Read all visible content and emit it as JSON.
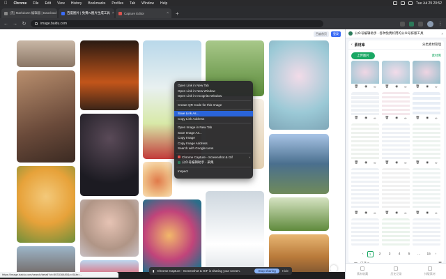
{
  "menubar": {
    "app": "Chrome",
    "menus": [
      "File",
      "Edit",
      "View",
      "History",
      "Bookmarks",
      "Profiles",
      "Tab",
      "Window",
      "Help"
    ],
    "clock": "Tue Jul 29 20:52"
  },
  "tabs": [
    {
      "label": "(无) Markdown 编辑器 | Daocloud"
    },
    {
      "label": "百度图片 | 免费AI图片生成工具"
    },
    {
      "label": "Capture Editor"
    }
  ],
  "address": {
    "url": "image.baidu.com"
  },
  "page": {
    "toolbar": {
      "btn1": "百度首页",
      "btn2": "登录"
    },
    "colors": {
      "accent": "#3b6cf6"
    }
  },
  "context_menu": {
    "items": [
      {
        "label": "Open Link in New Tab"
      },
      {
        "label": "Open Link in New Window"
      },
      {
        "label": "Open Link in Incognito Window"
      },
      {
        "label": "Create QR Code for this Image"
      },
      {
        "label": "Save Link As..."
      },
      {
        "label": "Copy Link Address"
      },
      {
        "label": "Open Image in New Tab"
      },
      {
        "label": "Save Image As..."
      },
      {
        "label": "Copy Image"
      },
      {
        "label": "Copy Image Address"
      },
      {
        "label": "Search with Google Lens"
      },
      {
        "label": "Chrome Capture - Screenshot & Gif"
      },
      {
        "label": "公众号编辑助手 - 采集"
      },
      {
        "label": "Inspect"
      }
    ]
  },
  "share_bar": {
    "text": "Chrome Capture - Screenshot & GIF is sharing your screen.",
    "stop": "Stop sharing",
    "hide": "Hide"
  },
  "status_url": "https://image.baidu.com/search/detail?ct=503316480&z=0&tn=...",
  "panel": {
    "title": "公众号编辑助手 - 各种免费好用的公众号排版工具",
    "library": {
      "title": "素材库",
      "manage": "分类素材管理",
      "upload": "上传图片",
      "select_all": "素材库"
    },
    "pager": [
      "1",
      "2",
      "3",
      "4",
      "5",
      "…",
      "15"
    ],
    "select_label": "已选 0",
    "bottom_nav": [
      "素材收藏",
      "历史记录",
      "排版素材"
    ]
  }
}
